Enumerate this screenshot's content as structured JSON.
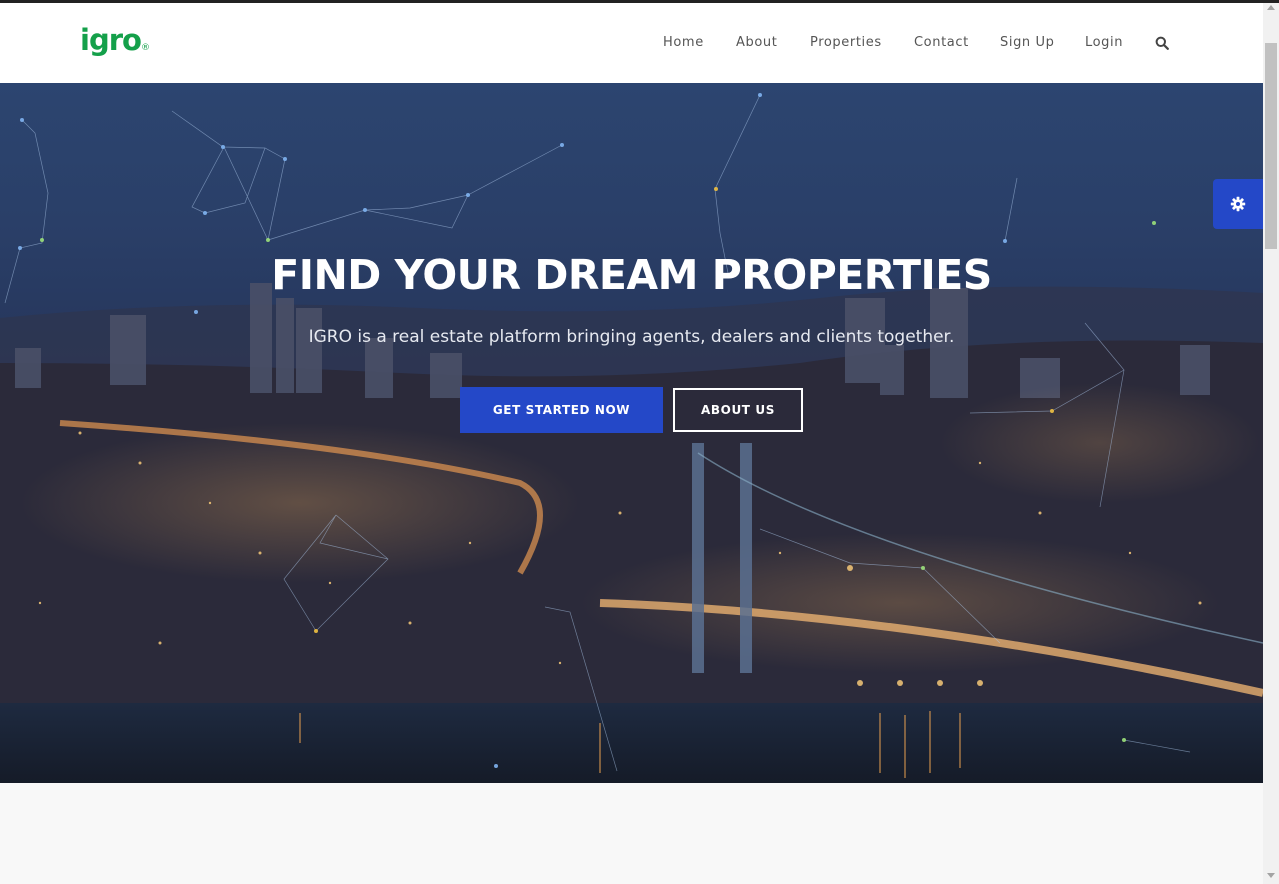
{
  "header": {
    "logo_text": "igro",
    "logo_mark": "®",
    "nav": [
      {
        "label": "Home"
      },
      {
        "label": "About"
      },
      {
        "label": "Properties"
      },
      {
        "label": "Contact"
      },
      {
        "label": "Sign Up"
      },
      {
        "label": "Login"
      }
    ],
    "search_icon": "search-icon"
  },
  "hero": {
    "title": "FIND YOUR DREAM PROPERTIES",
    "subtitle": "IGRO is a real estate platform bringing agents, dealers and clients together.",
    "primary_button": "GET STARTED NOW",
    "secondary_button": "ABOUT US",
    "background": "city-night-skyline-with-bridge"
  },
  "settings_tab": {
    "icon": "gear-icon"
  },
  "colors": {
    "brand_green": "#14a04a",
    "accent_blue": "#2448c8",
    "nav_text": "#555555",
    "hero_overlay": "#2a3f68"
  }
}
